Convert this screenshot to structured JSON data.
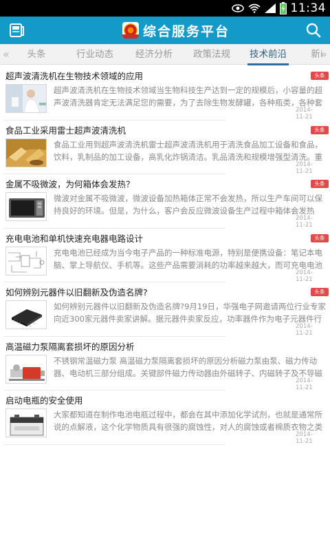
{
  "status_bar": {
    "time": "11:34"
  },
  "header": {
    "title": "综合服务平台"
  },
  "tabs": [
    {
      "label": "头条"
    },
    {
      "label": "行业动态"
    },
    {
      "label": "经济分析"
    },
    {
      "label": "政策法规"
    },
    {
      "label": "技术前沿"
    },
    {
      "label": "新i"
    }
  ],
  "active_tab": "技术前沿",
  "news": [
    {
      "title": "超声波清洗机在生物技术领域的应用",
      "badge": "头条",
      "summary": "超声波清洗机在生物技术领域当生物科技生产达到一定的规模后，小容量的超声波清洗器肯定无法满足您的需要，为了去除生物发酵罐，各种瓶类，各种套",
      "date": "2014-11-21",
      "thumb": "lab-scientist"
    },
    {
      "title": "食品工业采用雷士超声波清洗机",
      "badge": "头条",
      "summary": "食品工业用到超声波清洗机雷士超声波清洗机用于清洗食品加工设备和食品，饮料，乳制品的加工设备，高乳化炸锅清洁。乳品清洗和规模增强型清洗。重",
      "date": "2014-11-21",
      "thumb": "fried-food"
    },
    {
      "title": "金属不吸微波，为何箱体会发热？",
      "badge": "头条",
      "summary": "微波对金属不吸微波，微波设备加热箱体正常不会发热，所以生产车间可以保持良好的环境。但是，为什么，客户会反应微波设备生产过程中箱体会发热",
      "date": "2014-11-21",
      "thumb": "microwave"
    },
    {
      "title": "充电电池和单机快速充电器电路设计",
      "badge": "头条",
      "summary": "充电电池已经成为当今电子产品的一种标准电源，特别是便携设备：笔记本电脑、掌上导航仪、手机等。这些产品需要消耗的功率越来越大，而可充电电池",
      "date": "2014-11-21",
      "thumb": "circuit"
    },
    {
      "title": "如何辨别元器件以旧翻新及伪造名牌?",
      "badge": "头条",
      "summary": "如何辨别元器件以旧翻新及伪造名牌?9月19日，华强电子网邀请两位行业专家向近300家元器件卖家讲解。据元器件卖家反应，功率器件作为电子元器件行业",
      "date": "2014-11-21",
      "thumb": "chip"
    },
    {
      "title": "高温磁力泵隔离套损坏的原因分析",
      "badge": "",
      "summary": "不锈钢常温磁力泵 高温磁力泵隔离套损坏的原因分析磁力泵由泵、磁力传动器、电动机三部分组成。关键部件磁力传动器由外磁转子、内磁转子及不导磁",
      "date": "2014-11-21",
      "thumb": "pump"
    },
    {
      "title": "启动电瓶的安全使用",
      "badge": "",
      "summary": "大家都知道在制作电池电瓶过程中，都会在其中添加化学试剂，也就是通常所说的点解液，这个化学物质具有很强的腐蚀性，对人的腐蚀或者棉质衣物之类",
      "date": "2014-11-21",
      "thumb": "battery"
    }
  ]
}
